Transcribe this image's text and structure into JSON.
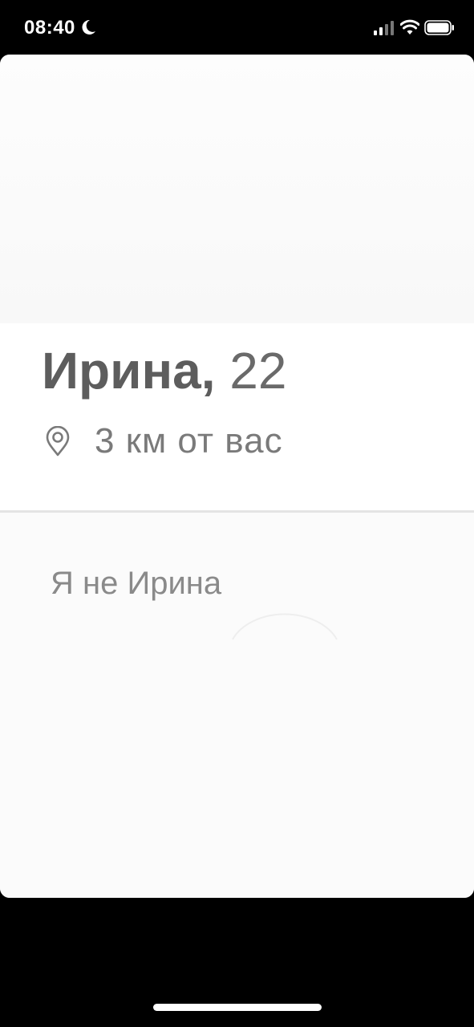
{
  "status_bar": {
    "time": "08:40",
    "icons": [
      "moon-icon",
      "signal-icon",
      "wifi-icon",
      "battery-icon"
    ]
  },
  "profile": {
    "name": "Ирина,",
    "age": "22",
    "distance": "3 км от вас",
    "location_icon": "location-pin-icon",
    "bio": "Я не Ирина"
  },
  "colors": {
    "background": "#000000",
    "card": "#ffffff",
    "name_text": "#5d5d5d",
    "secondary_text": "#7a7a7a",
    "bio_text": "#8a8a8a",
    "divider": "#e4e4e4"
  }
}
